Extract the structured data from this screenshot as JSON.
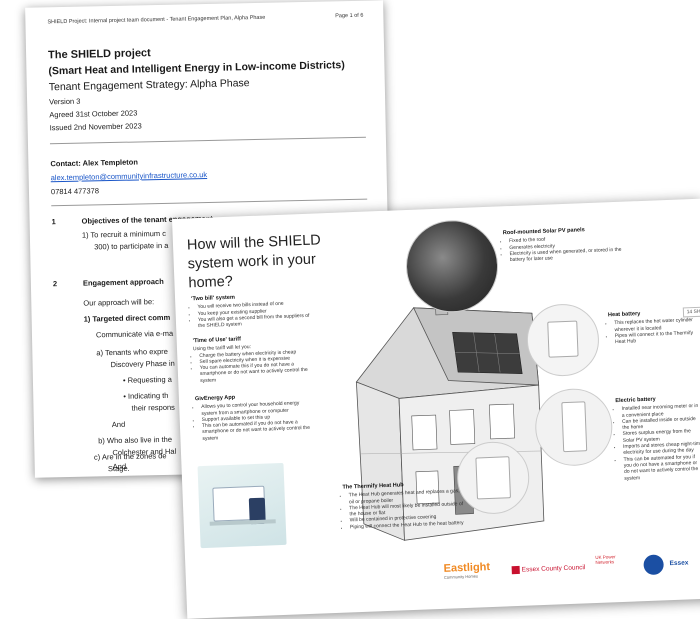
{
  "page1": {
    "header_left": "SHIELD Project: Internal project team document - Tenant Engagement Plan, Alpha Phase",
    "header_right": "Page 1 of 6",
    "title": "The SHIELD project",
    "subtitle": "(Smart Heat and Intelligent Energy in Low-income Districts)",
    "strategy": "Tenant Engagement Strategy: Alpha Phase",
    "version": "Version 3",
    "agreed": "Agreed 31st October 2023",
    "issued": "Issued 2nd November 2023",
    "contact_label": "Contact: Alex Templeton",
    "email": "alex.templeton@communityinfrastructure.co.uk",
    "phone": "07814 477378",
    "sec1_num": "1",
    "sec1_title": "Objectives of the tenant engagement",
    "sec1_item1a": "1)  To recruit a minimum c",
    "sec1_item1b": "300) to participate in a",
    "sec2_num": "2",
    "sec2_title": "Engagement approach",
    "approach": "Our approach will be:",
    "item1": "1)  Targeted direct comm",
    "communicate": "Communicate via e-ma",
    "a1": "a)  Tenants who expre",
    "a2": "Discovery Phase in",
    "bullet1": "•   Requesting a",
    "bullet2a": "•   Indicating th",
    "bullet2b": "their respons",
    "and1": "And",
    "b1": "b)  Who also live in the",
    "b2": "Colchester and Hal",
    "and2": "And",
    "c1": "c)  Are in the zones de",
    "c2": "Stage."
  },
  "page2": {
    "title": "How will the SHIELD system work in your home?",
    "tag": "14 SHI",
    "two_bill": {
      "heading": "'Two bill' system",
      "items": [
        "You will receive two bills instead of one",
        "You keep your existing supplier",
        "You will also get a second bill from the suppliers of the SHIELD system"
      ]
    },
    "tou": {
      "heading": "'Time of Use' tariff",
      "intro": "Using the tariff will let you:",
      "items": [
        "Charge the battery when electricity is cheap",
        "Sell spare electricity when it is expensive",
        "You can automate this if you do not have a smartphone or do not want to actively control the system"
      ]
    },
    "givenergy": {
      "heading": "GivEnergy App",
      "items": [
        "Allows you to control your household energy system from a smartphone or computer",
        "Support available to set this up",
        "This can be automated if you do not have a smartphone or do not want to actively control the system"
      ]
    },
    "solar": {
      "heading": "Roof-mounted Solar PV panels",
      "items": [
        "Fixed to the roof",
        "Generates electricity",
        "Electricity is used when generated, or stored in the battery for later use"
      ]
    },
    "heat_battery": {
      "heading": "Heat battery",
      "items": [
        "This replaces the hot water cylinder wherever it is located",
        "Pipes will connect it to the Thermify Heat Hub"
      ]
    },
    "electric_battery": {
      "heading": "Electric battery",
      "items": [
        "Installed near incoming meter or in a convenient place",
        "Can be installed inside or outside the home",
        "Stores surplus energy from the Solar PV system",
        "Imports and stores cheap night-time electricity for use during the day",
        "This can be automated for you if you do not have a smartphone or do not want to actively control the system"
      ]
    },
    "heat_hub": {
      "heading": "The Thermify Heat Hub",
      "items": [
        "The Heat Hub generates heat and replaces a gas, oil or propane boiler",
        "The Heat Hub will most likely be installed outside of the house or flat",
        "Will be contained in protective covering",
        "Piping will connect the Heat Hub to the heat battery"
      ]
    },
    "logos": {
      "eastlight": "Eastlight",
      "eastlight_sub": "Community Homes",
      "essex": "Essex County Council",
      "ukpn": "UK Power Networks",
      "essex2": "Essex"
    },
    "colors": {
      "eastlight_orange": "#f08a24",
      "essex_red": "#c8102e",
      "ukpn_red": "#d22630",
      "essex_blue": "#1b4fa3"
    }
  }
}
